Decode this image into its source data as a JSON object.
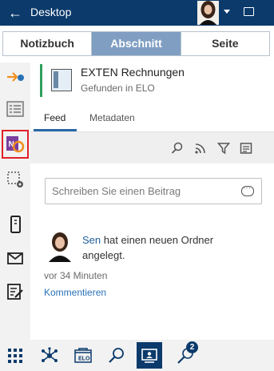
{
  "header": {
    "title": "Desktop"
  },
  "segments": [
    "Notizbuch",
    "Abschnitt",
    "Seite"
  ],
  "active_segment": "Abschnitt",
  "document": {
    "name": "EXTEN Rechnungen",
    "subtitle": "Gefunden in ELO"
  },
  "tabs": [
    "Feed",
    "Metadaten"
  ],
  "post": {
    "placeholder": "Schreiben Sie einen Beitrag"
  },
  "feed_item": {
    "user": "Sen",
    "text": "hat einen neuen Ordner angelegt.",
    "time": "vor 34 Minuten",
    "action": "Kommentieren"
  },
  "bottom_nav": {
    "badge_count": "2",
    "elo_label": "ELO"
  },
  "sidebar_icon_text": {
    "onenote": "N"
  },
  "colors": {
    "header": "#0b3a6b",
    "accent_green": "#2fa05b",
    "segment_active": "#7f9ec2",
    "link": "#2a72b8",
    "selected_outline": "#e0202a"
  }
}
